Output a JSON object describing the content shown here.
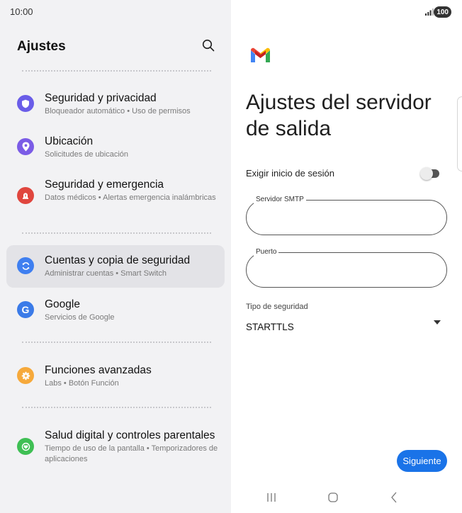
{
  "status": {
    "time": "10:00",
    "battery": "100"
  },
  "settings": {
    "title": "Ajustes",
    "items": [
      {
        "title": "Seguridad y privacidad",
        "subtitle": "Bloqueador automático • Uso de permisos",
        "icon": "shield-icon",
        "color": "#6a5de8"
      },
      {
        "title": "Ubicación",
        "subtitle": "Solicitudes de ubicación",
        "icon": "location-pin-icon",
        "color": "#7b5ce6"
      },
      {
        "title": "Seguridad y emergencia",
        "subtitle": "Datos médicos • Alertas emergencia inalámbricas",
        "icon": "emergency-siren-icon",
        "color": "#e0463e"
      },
      {
        "title": "Cuentas y copia de seguridad",
        "subtitle": "Administrar cuentas • Smart Switch",
        "icon": "sync-icon",
        "color": "#3f7ff0"
      },
      {
        "title": "Google",
        "subtitle": "Servicios de Google",
        "icon": "google-icon",
        "color": "#3b7be8"
      },
      {
        "title": "Funciones avanzadas",
        "subtitle": "Labs • Botón Función",
        "icon": "gear-plus-icon",
        "color": "#f6a93b"
      },
      {
        "title": "Salud digital y controles parentales",
        "subtitle": "Tiempo de uso de la pantalla • Temporizadores de aplicaciones",
        "icon": "heart-circle-icon",
        "color": "#3fbf54"
      }
    ]
  },
  "outgoing": {
    "title": "Ajustes del servidor de salida",
    "require_login_label": "Exigir inicio de sesión",
    "require_login_on": false,
    "smtp_label": "Servidor SMTP",
    "smtp_value": "",
    "port_label": "Puerto",
    "port_value": "",
    "security_label": "Tipo de seguridad",
    "security_value": "STARTTLS",
    "next_label": "Siguiente"
  },
  "colors": {
    "accent": "#1a73e8",
    "left_bg": "#f2f2f4",
    "selected_bg": "#e3e3e7"
  }
}
